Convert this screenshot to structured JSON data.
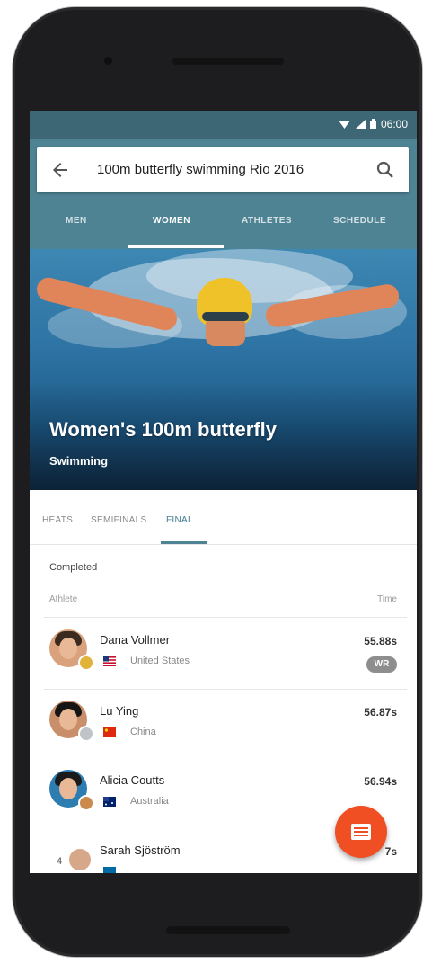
{
  "status_bar": {
    "time": "06:00"
  },
  "search": {
    "query": "100m butterfly swimming Rio 2016"
  },
  "tabs": [
    {
      "label": "MEN",
      "active": false
    },
    {
      "label": "WOMEN",
      "active": true
    },
    {
      "label": "ATHLETES",
      "active": false
    },
    {
      "label": "SCHEDULE",
      "active": false
    }
  ],
  "hero": {
    "title": "Women's 100m butterfly",
    "subtitle": "Swimming"
  },
  "subtabs": [
    {
      "label": "HEATS",
      "active": false
    },
    {
      "label": "SEMIFINALS",
      "active": false
    },
    {
      "label": "FINAL",
      "active": true
    }
  ],
  "results": {
    "status": "Completed",
    "col_athlete": "Athlete",
    "col_time": "Time",
    "rows": [
      {
        "name": "Dana Vollmer",
        "country": "United States",
        "time": "55.88s",
        "badge": "WR",
        "medal_color": "#e2b33b",
        "flag": "us-flag"
      },
      {
        "name": "Lu Ying",
        "country": "China",
        "time": "56.87s",
        "badge": "",
        "medal_color": "#c0c4c8",
        "flag": "china-flag"
      },
      {
        "name": "Alicia Coutts",
        "country": "Australia",
        "time": "56.94s",
        "badge": "",
        "medal_color": "#c98a4b",
        "flag": "australia-flag"
      },
      {
        "name": "Sarah Sjöström",
        "country": "",
        "time": "7s",
        "badge": "",
        "rank": "4",
        "flag": ""
      }
    ]
  },
  "colors": {
    "primary": "#4e8394",
    "status_bar": "#3d6775",
    "accent": "#f04e23"
  }
}
